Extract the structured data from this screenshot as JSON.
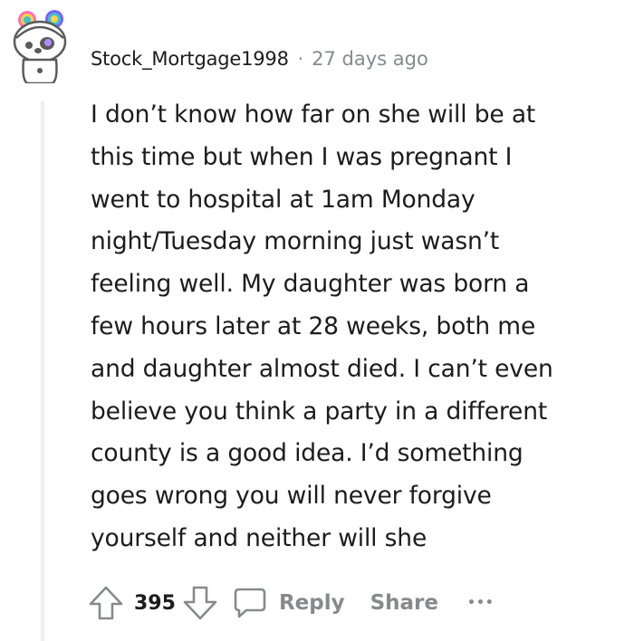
{
  "comment": {
    "username": "Stock_Mortgage1998",
    "separator": "·",
    "timestamp": "27 days ago",
    "body_lines": [
      "I don’t know how far on she will be at",
      "this time but when I was pregnant I",
      "went to hospital at 1am Monday",
      "night/Tuesday morning just wasn’t",
      "feeling well. My daughter was born a",
      "few hours later at 28 weeks, both me",
      "and daughter almost died. I can’t even",
      "believe you think a party in a different",
      "county is a good idea. I’d something",
      "goes wrong you will never forgive",
      "yourself and neither will she"
    ],
    "vote_count": "395",
    "reply_label": "Reply",
    "share_label": "Share",
    "more_label": "•••"
  },
  "icons": {
    "avatar": "snoo-avatar-icon",
    "upvote": "upvote-arrow-icon",
    "downvote": "downvote-arrow-icon",
    "reply": "speech-bubble-icon",
    "more": "ellipsis-icon"
  },
  "colors": {
    "text": "#1c1c1c",
    "muted": "#878a8c",
    "thread_line": "#edeff1"
  }
}
